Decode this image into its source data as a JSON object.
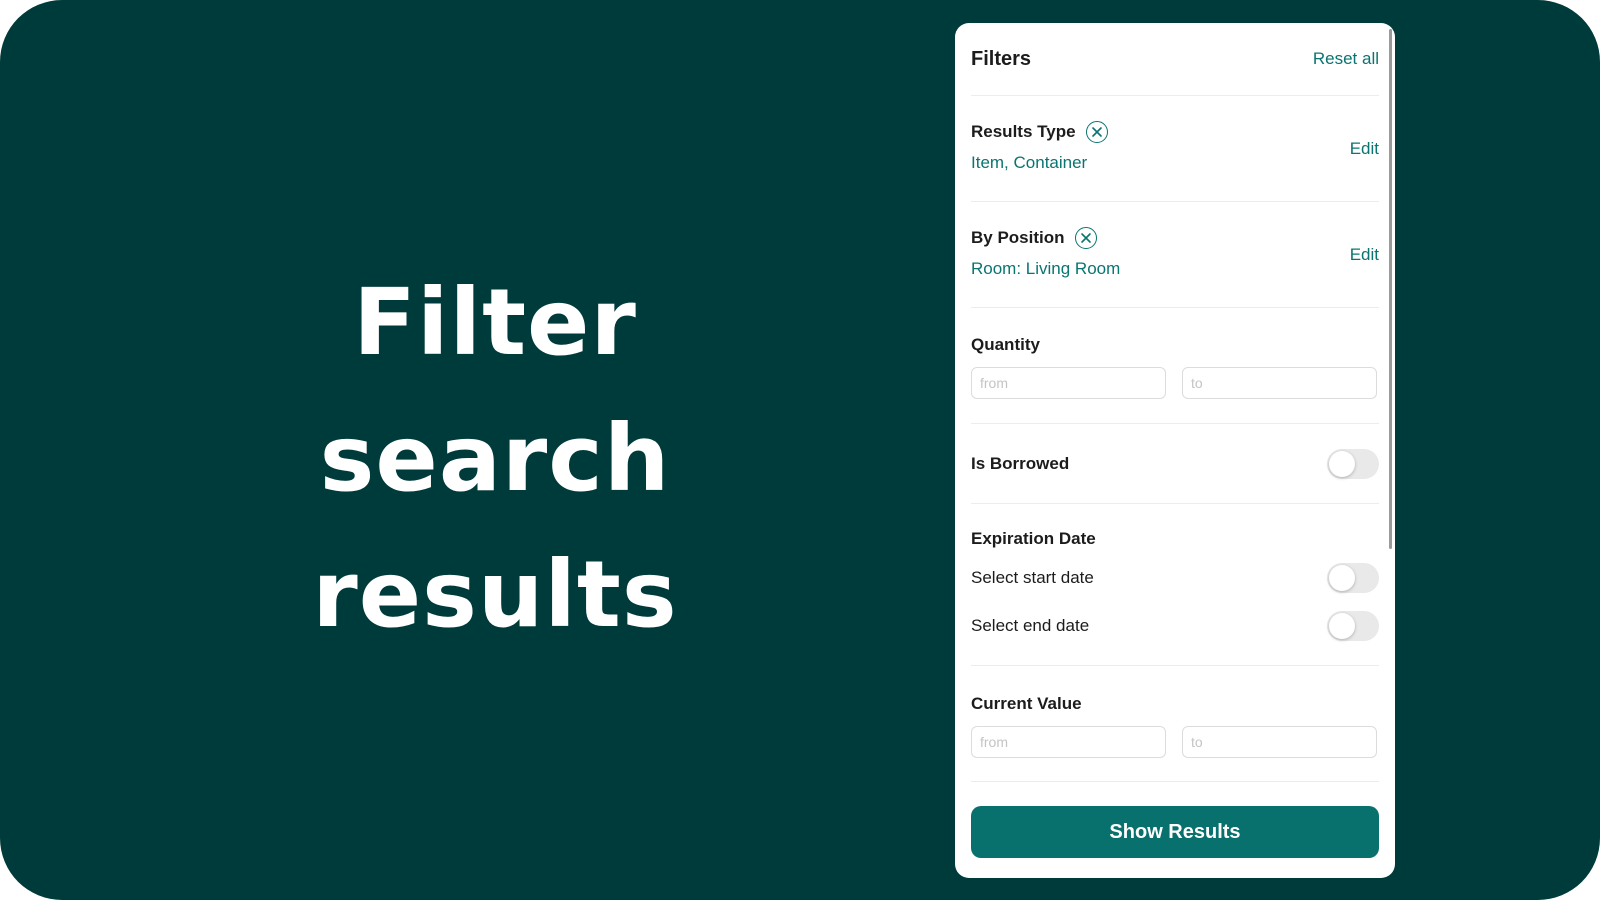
{
  "headline": {
    "line1": "Filter",
    "line2": "search results"
  },
  "filters": {
    "title": "Filters",
    "reset_label": "Reset all",
    "results_type": {
      "label": "Results Type",
      "value": "Item, Container",
      "edit_label": "Edit"
    },
    "by_position": {
      "label": "By Position",
      "value": "Room: Living Room",
      "edit_label": "Edit"
    },
    "quantity": {
      "label": "Quantity",
      "from_placeholder": "from",
      "to_placeholder": "to"
    },
    "is_borrowed": {
      "label": "Is Borrowed",
      "enabled": false
    },
    "expiration_date": {
      "label": "Expiration Date",
      "start_label": "Select start date",
      "end_label": "Select end date"
    },
    "current_value": {
      "label": "Current Value",
      "from_placeholder": "from",
      "to_placeholder": "to"
    },
    "show_results_label": "Show Results"
  },
  "colors": {
    "background": "#003b3b",
    "accent": "#0a7470",
    "button": "#08706d"
  },
  "icons": {
    "clear": "circle-x-icon"
  }
}
